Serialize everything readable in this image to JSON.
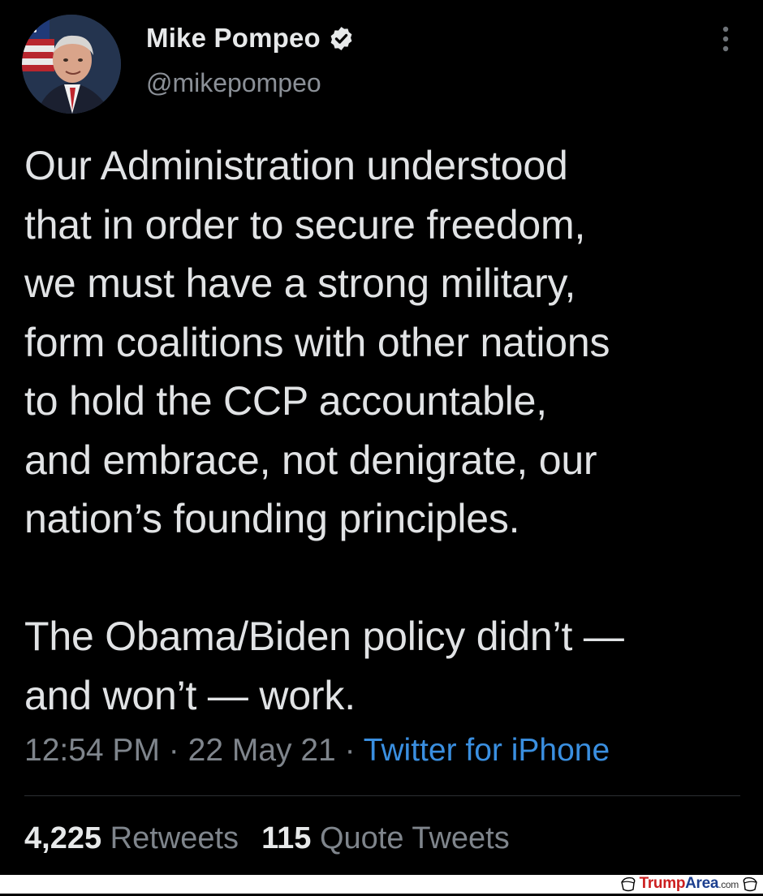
{
  "author": {
    "display_name": "Mike Pompeo",
    "handle": "@mikepompeo",
    "verified_icon": "verified-badge-icon",
    "avatar": "profile-photo-man-with-flag-background"
  },
  "tweet": {
    "text": "Our Administration understood\nthat in order to secure freedom,\nwe must have a strong military,\nform coalitions with other nations\nto hold the CCP accountable,\nand embrace, not denigrate, our\nnation’s founding principles.\n\nThe Obama/Biden policy didn’t —\nand won’t — work.",
    "time": "12:54 PM",
    "date": "22 May 21",
    "separator": "·",
    "source": "Twitter for iPhone"
  },
  "stats": {
    "retweets_count": "4,225",
    "retweets_label": "Retweets",
    "quotes_count": "115",
    "quotes_label": "Quote Tweets"
  },
  "watermark": {
    "brand_red": "Trump",
    "brand_blue": "Area",
    "brand_domain": ".com"
  },
  "colors": {
    "background": "#000000",
    "text": "#e1e3e5",
    "muted": "#7f858c",
    "link": "#3a8fe0"
  }
}
